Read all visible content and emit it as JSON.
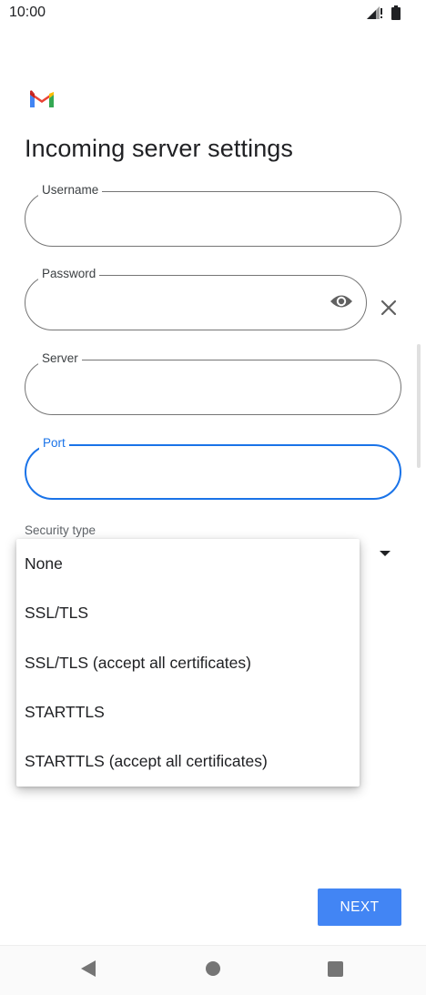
{
  "status_bar": {
    "time": "10:00"
  },
  "page": {
    "title": "Incoming server settings"
  },
  "fields": {
    "username": {
      "label": "Username",
      "value": ""
    },
    "password": {
      "label": "Password",
      "value": ""
    },
    "server": {
      "label": "Server",
      "value": ""
    },
    "port": {
      "label": "Port",
      "value": ""
    }
  },
  "security": {
    "label": "Security type",
    "options": [
      "None",
      "SSL/TLS",
      "SSL/TLS (accept all certificates)",
      "STARTTLS",
      "STARTTLS (accept all certificates)"
    ]
  },
  "actions": {
    "next_label": "NEXT"
  },
  "colors": {
    "accent": "#1a73e8",
    "button": "#4285f4"
  },
  "icons": [
    "gmail-logo-icon",
    "signal-icon",
    "battery-icon",
    "eye-icon",
    "close-icon",
    "dropdown-arrow-icon",
    "back-icon",
    "home-icon",
    "recents-icon"
  ]
}
